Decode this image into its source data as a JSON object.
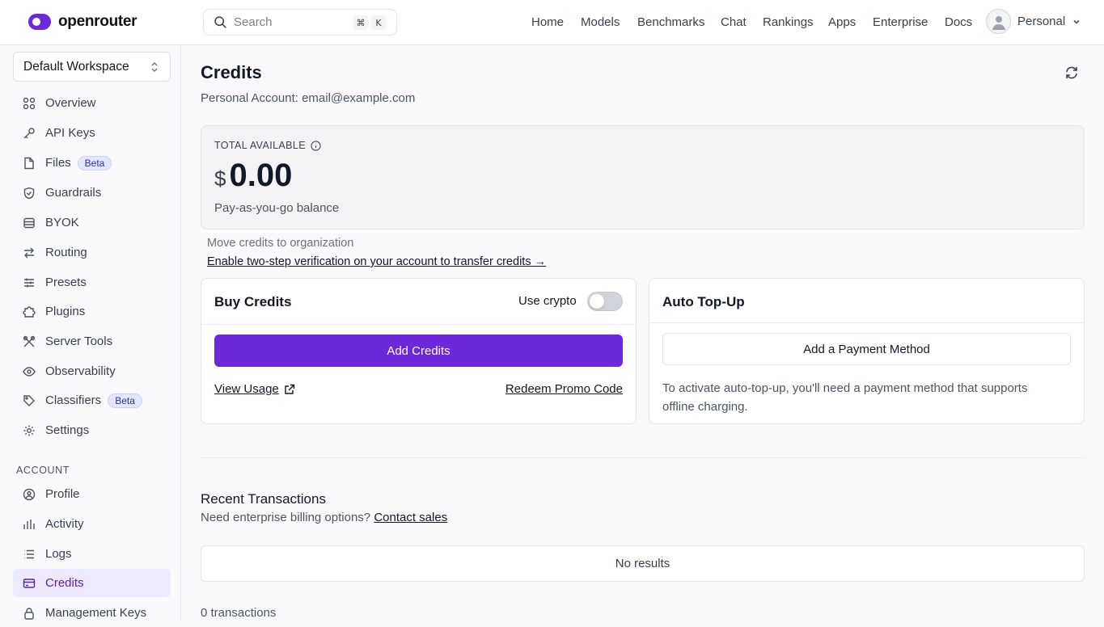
{
  "header": {
    "logo_text": "openrouter",
    "search": {
      "placeholder": "Search",
      "shortcut_mod": "⌘",
      "shortcut_key": "K"
    },
    "nav": [
      "Home",
      "Models",
      "Benchmarks",
      "Chat",
      "Rankings",
      "Apps",
      "Enterprise",
      "Docs"
    ],
    "account_label": "Personal"
  },
  "sidebar": {
    "workspace": "Default Workspace",
    "items": [
      {
        "label": "Overview",
        "icon": "grid-icon"
      },
      {
        "label": "API Keys",
        "icon": "key-icon"
      },
      {
        "label": "Files",
        "icon": "file-icon",
        "badge": "Beta"
      },
      {
        "label": "Guardrails",
        "icon": "shield-icon"
      },
      {
        "label": "BYOK",
        "icon": "database-icon"
      },
      {
        "label": "Routing",
        "icon": "arrows-icon"
      },
      {
        "label": "Presets",
        "icon": "sliders-icon"
      },
      {
        "label": "Plugins",
        "icon": "puzzle-icon"
      },
      {
        "label": "Server Tools",
        "icon": "tools-icon"
      },
      {
        "label": "Observability",
        "icon": "eye-icon"
      },
      {
        "label": "Classifiers",
        "icon": "tag-icon",
        "badge": "Beta"
      },
      {
        "label": "Settings",
        "icon": "gear-icon"
      }
    ],
    "account_section": "ACCOUNT",
    "account_items": [
      {
        "label": "Profile",
        "icon": "user-circle-icon"
      },
      {
        "label": "Activity",
        "icon": "bar-chart-icon"
      },
      {
        "label": "Logs",
        "icon": "list-icon"
      },
      {
        "label": "Credits",
        "icon": "credit-card-icon",
        "active": true
      },
      {
        "label": "Management Keys",
        "icon": "lock-icon"
      }
    ]
  },
  "main": {
    "title": "Credits",
    "subtitle": "Personal Account: email@example.com",
    "balance": {
      "label": "TOTAL AVAILABLE",
      "currency": "$",
      "amount": "0.00",
      "description": "Pay-as-you-go balance"
    },
    "move_label": "Move credits to organization",
    "twostep_link": "Enable two-step verification on your account to transfer credits →",
    "buy": {
      "title": "Buy Credits",
      "crypto_label": "Use crypto",
      "crypto_enabled": false,
      "add_button": "Add Credits",
      "view_usage": "View Usage",
      "redeem": "Redeem Promo Code"
    },
    "topup": {
      "title": "Auto Top-Up",
      "payment_button": "Add a Payment Method",
      "description": "To activate auto-top-up, you'll need a payment method that supports offline charging."
    },
    "transactions": {
      "title": "Recent Transactions",
      "billing_prefix": "Need enterprise billing options?",
      "contact_link": "Contact sales",
      "empty": "No results",
      "count": "0 transactions"
    }
  },
  "colors": {
    "accent": "#6d28d9",
    "active_bg": "#ede9fe",
    "active_text": "#5b21b6"
  }
}
